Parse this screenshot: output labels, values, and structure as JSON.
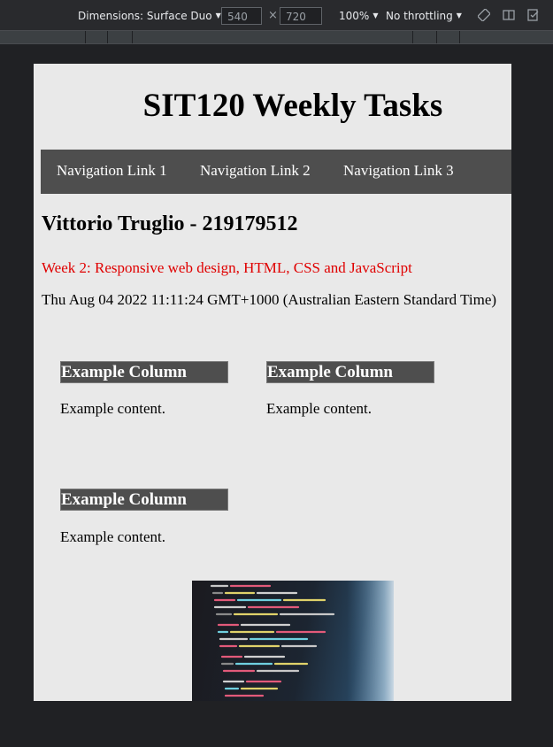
{
  "devtools": {
    "device_label": "Dimensions: Surface Duo",
    "width": "540",
    "height": "720",
    "zoom": "100%",
    "throttling": "No throttling"
  },
  "page": {
    "title": "SIT120 Weekly Tasks",
    "nav": [
      "Navigation Link 1",
      "Navigation Link 2",
      "Navigation Link 3"
    ],
    "author": "Vittorio Truglio - 219179512",
    "week": "Week 2: Responsive web design, HTML, CSS and JavaScript",
    "date": "Thu Aug 04 2022 11:11:24 GMT+1000 (Australian Eastern Standard Time)",
    "columns": [
      {
        "heading": "Example Column",
        "content": "Example content."
      },
      {
        "heading": "Example Column",
        "content": "Example content."
      },
      {
        "heading": "Example Column",
        "content": "Example content."
      }
    ]
  },
  "colors": {
    "page_bg": "#e9e9e9",
    "nav_bg": "#4e4e4e",
    "week_text": "#e00000"
  }
}
